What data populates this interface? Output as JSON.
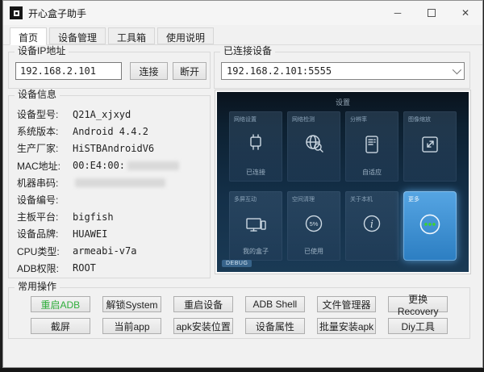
{
  "window": {
    "title": "开心盒子助手",
    "minimize_glyph": "─",
    "close_glyph": "✕"
  },
  "tabs": [
    {
      "label": "首页"
    },
    {
      "label": "设备管理"
    },
    {
      "label": "工具箱"
    },
    {
      "label": "使用说明"
    }
  ],
  "ip_group": {
    "title": "设备IP地址",
    "value": "192.168.2.101",
    "connect_label": "连接",
    "disconnect_label": "断开"
  },
  "connected_group": {
    "title": "已连接设备",
    "selected_device": "192.168.2.101:5555"
  },
  "info_group": {
    "title": "设备信息",
    "rows": [
      {
        "label": "设备型号:",
        "value": "Q21A_xjxyd"
      },
      {
        "label": "系统版本:",
        "value": "Android 4.4.2"
      },
      {
        "label": "生产厂家:",
        "value": "HiSTBAndroidV6"
      },
      {
        "label": "MAC地址:",
        "value": "00:E4:00:"
      },
      {
        "label": "机器串码:",
        "value": ""
      },
      {
        "label": "设备编号:",
        "value": ""
      },
      {
        "label": "主板平台:",
        "value": "bigfish"
      },
      {
        "label": "设备品牌:",
        "value": "HUAWEI"
      },
      {
        "label": "CPU类型:",
        "value": "armeabi-v7a"
      },
      {
        "label": "ADB权限:",
        "value": "ROOT"
      }
    ]
  },
  "screen": {
    "title": "设置",
    "debug_label": "DEBUG",
    "tiles": [
      {
        "header": "网络设置",
        "footer": "已连接",
        "icon": "network-plug-icon"
      },
      {
        "header": "网络检测",
        "footer": "",
        "icon": "globe-search-icon"
      },
      {
        "header": "分辨率",
        "footer": "自适应",
        "icon": "resolution-list-icon"
      },
      {
        "header": "图像缩放",
        "footer": "",
        "icon": "scale-arrows-icon"
      },
      {
        "header": "多屏互动",
        "footer": "我的盒子",
        "icon": "monitor-icon"
      },
      {
        "header": "空间清理",
        "footer": "已使用",
        "center_text": "5%",
        "icon": "storage-percent-icon"
      },
      {
        "header": "关于本机",
        "footer": "",
        "glyph": "i",
        "icon": "info-icon"
      },
      {
        "header": "更多",
        "footer": "",
        "icon": "more-dots-icon",
        "selected": true
      }
    ]
  },
  "actions_group": {
    "title": "常用操作",
    "row1": [
      "重启ADB",
      "解锁System",
      "重启设备",
      "ADB Shell",
      "文件管理器",
      "更换Recovery"
    ],
    "row2": [
      "截屏",
      "当前app",
      "apk安装位置",
      "设备属性",
      "批量安装apk",
      "Diy工具"
    ]
  },
  "colors": {
    "accent_green": "#2fae3b",
    "tile_selected_blue": "#2c7ec2",
    "dot_green": "#3ed32f",
    "screen_bg": "#143049"
  }
}
